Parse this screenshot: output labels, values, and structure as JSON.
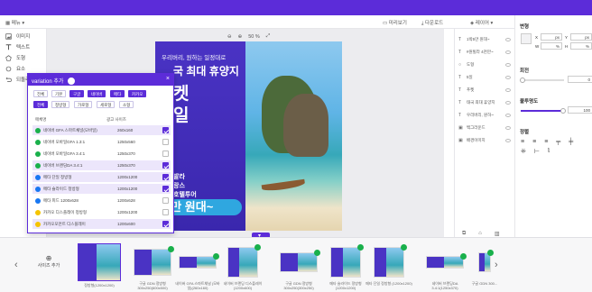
{
  "toolbar": {
    "menu_label": "메뉴",
    "preview_label": "미리보기",
    "download_label": "다운로드",
    "layers_label": "레이어"
  },
  "left_panel": {
    "items": [
      {
        "label": "이미지",
        "icon": "image-icon"
      },
      {
        "label": "텍스트",
        "icon": "text-icon"
      },
      {
        "label": "도형",
        "icon": "shape-icon"
      },
      {
        "label": "요소",
        "icon": "element-icon"
      },
      {
        "label": "되돌리기",
        "icon": "undo-icon"
      }
    ]
  },
  "zoom": {
    "value": "50 %"
  },
  "artboard": {
    "line1": "우리버리, 원하는 일정대로",
    "line2": "국 최대 휴양지",
    "line3": "켓",
    "line4": "일",
    "line5": "발라",
    "line6": "랑스",
    "line7": "호텔투어",
    "price": "9만 원대~"
  },
  "variation_modal": {
    "title": "variation 추가",
    "close": "×",
    "filters_row1": [
      "전체",
      "기본",
      "구글",
      "네이버",
      "메타",
      "카카오"
    ],
    "filters_row1_active": [
      "구글",
      "네이버",
      "메타",
      "카카오"
    ],
    "filters_row2": [
      "전체",
      "정방형",
      "가로형",
      "세로형",
      "소형"
    ],
    "filters_row2_active": [
      "전체"
    ],
    "col_name": "매체명",
    "col_size": "광고 사이즈",
    "rows": [
      {
        "name": "네이버 GFA 스마트채널(모바일)",
        "size": "260x160",
        "color": "#19b04b",
        "checked": true
      },
      {
        "name": "네이버 모바일GFA 1.3:1",
        "size": "1250x560",
        "color": "#19b04b",
        "checked": false
      },
      {
        "name": "네이버 모바일GFA 3.4:1",
        "size": "1250x370",
        "color": "#19b04b",
        "checked": false
      },
      {
        "name": "네이버 브랜딩DA 3.4:1",
        "size": "1250x370",
        "color": "#19b04b",
        "checked": true
      },
      {
        "name": "메타 단일 정방형",
        "size": "1200x1200",
        "color": "#1877f2",
        "checked": true
      },
      {
        "name": "메타 슬라이드 정방형",
        "size": "1200x1200",
        "color": "#1877f2",
        "checked": true
      },
      {
        "name": "메타 피드 1200x628",
        "size": "1200x628",
        "color": "#1877f2",
        "checked": false
      },
      {
        "name": "카카오 디스플레이 정방형",
        "size": "1200x1200",
        "color": "#f5c400",
        "checked": false
      },
      {
        "name": "카카오모먼트 디스플레이",
        "size": "1200x600",
        "color": "#f5c400",
        "checked": true
      }
    ]
  },
  "layers": {
    "items": [
      {
        "label": "1박5만 원대~",
        "icon": "T"
      },
      {
        "label": "#원빌라 4천만~",
        "icon": "T"
      },
      {
        "label": "도형",
        "icon": "○"
      },
      {
        "label": "5일",
        "icon": "T"
      },
      {
        "label": "푸켓",
        "icon": "T"
      },
      {
        "label": "태국 최대 휴양지",
        "icon": "T"
      },
      {
        "label": "우리버리, 원하~",
        "icon": "T"
      },
      {
        "label": "백그라운드",
        "icon": "▣"
      },
      {
        "label": "배경이미지",
        "icon": "▣"
      }
    ]
  },
  "properties": {
    "position_title": "변형",
    "x_label": "X",
    "x_unit": "px",
    "y_label": "Y",
    "y_unit": "px",
    "w_label": "W",
    "w_unit": "%",
    "h_label": "H",
    "h_unit": "%",
    "rotation_title": "회전",
    "rotation_value": "0",
    "opacity_title": "불투명도",
    "opacity_value": "100",
    "align_title": "정렬"
  },
  "filmstrip": {
    "add_label": "사이즈 추가",
    "thumbs": [
      {
        "caption": "정방형(1200x1200)"
      },
      {
        "caption": "구글 GDN 정방형 300x250(600x500)"
      },
      {
        "caption": "네이버 GFA 스마트채널 (모바일)(260x160)"
      },
      {
        "caption": "네이버 브랜딩 디스플레이 (1200x600)"
      },
      {
        "caption": "구글 GDN 정방형 300x250(300x250)"
      },
      {
        "caption": "메타 슬라이드 정방형 (1200x1200)"
      },
      {
        "caption": "메타 단일 정방형 (1200x1200)"
      },
      {
        "caption": "네이버 브랜딩DA 3.4:1(1250x370)"
      },
      {
        "caption": "구글 GDN 300..."
      }
    ]
  }
}
